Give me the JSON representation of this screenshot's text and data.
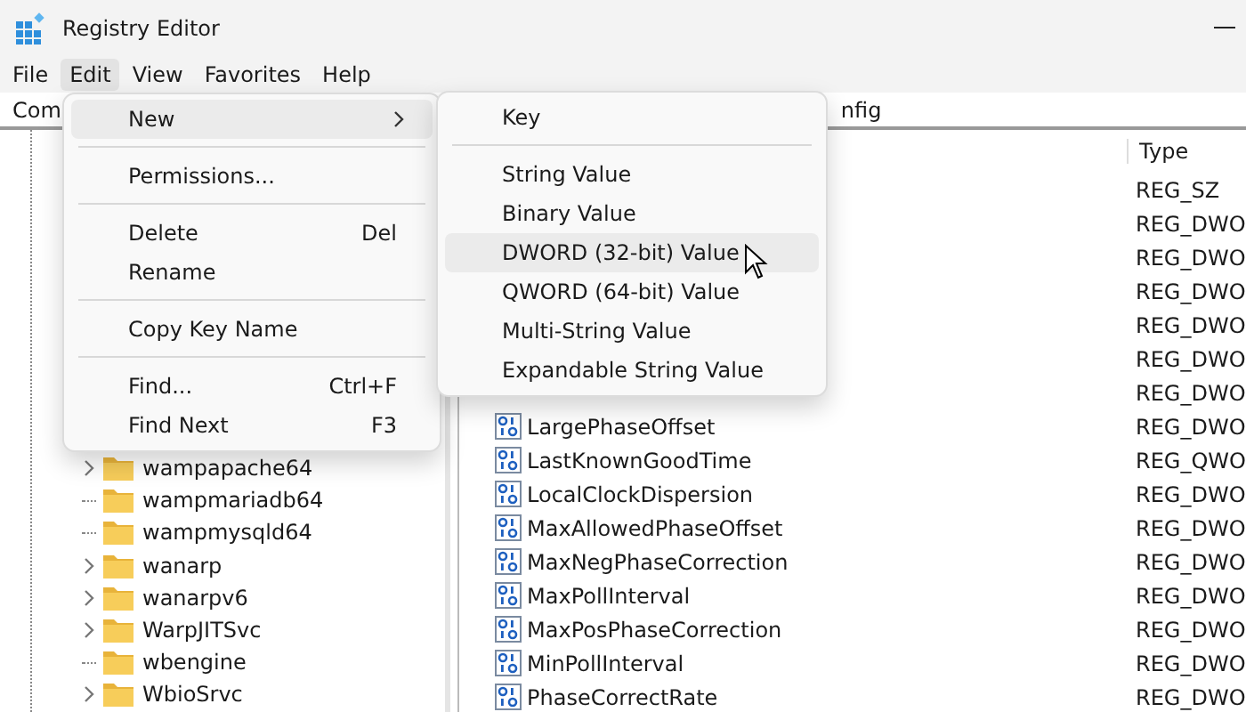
{
  "window": {
    "title": "Registry Editor"
  },
  "menubar": [
    {
      "label": "File",
      "selected": false
    },
    {
      "label": "Edit",
      "selected": true
    },
    {
      "label": "View",
      "selected": false
    },
    {
      "label": "Favorites",
      "selected": false
    },
    {
      "label": "Help",
      "selected": false
    }
  ],
  "address": {
    "start": "Com",
    "end": "nfig"
  },
  "tree": [
    {
      "label": "wampapache64",
      "expandable": true
    },
    {
      "label": "wampmariadb64",
      "expandable": false
    },
    {
      "label": "wampmysqld64",
      "expandable": false
    },
    {
      "label": "wanarp",
      "expandable": true
    },
    {
      "label": "wanarpv6",
      "expandable": true
    },
    {
      "label": "WarpJITSvc",
      "expandable": true
    },
    {
      "label": "wbengine",
      "expandable": false
    },
    {
      "label": "WbioSrvc",
      "expandable": true
    }
  ],
  "values": {
    "type_header": "Type",
    "rows": [
      {
        "type": "REG_SZ"
      },
      {
        "type": "REG_DWO"
      },
      {
        "type": "REG_DWO"
      },
      {
        "type": "REG_DWO"
      },
      {
        "type": "REG_DWO"
      },
      {
        "type": "REG_DWO"
      },
      {
        "type": "REG_DWO"
      },
      {
        "name": "LargePhaseOffset",
        "type": "REG_DWO"
      },
      {
        "name": "LastKnownGoodTime",
        "type": "REG_QWO"
      },
      {
        "name": "LocalClockDispersion",
        "type": "REG_DWO"
      },
      {
        "name": "MaxAllowedPhaseOffset",
        "type": "REG_DWO"
      },
      {
        "name": "MaxNegPhaseCorrection",
        "type": "REG_DWO"
      },
      {
        "name": "MaxPollInterval",
        "type": "REG_DWO"
      },
      {
        "name": "MaxPosPhaseCorrection",
        "type": "REG_DWO"
      },
      {
        "name": "MinPollInterval",
        "type": "REG_DWO"
      },
      {
        "name": "PhaseCorrectRate",
        "type": "REG_DWO"
      }
    ]
  },
  "edit_menu": [
    {
      "kind": "item",
      "label": "New",
      "submenu": true,
      "selected": true
    },
    {
      "kind": "separator"
    },
    {
      "kind": "item",
      "label": "Permissions...",
      "selected": false
    },
    {
      "kind": "separator"
    },
    {
      "kind": "item",
      "label": "Delete",
      "shortcut": "Del",
      "selected": false
    },
    {
      "kind": "item",
      "label": "Rename",
      "selected": false
    },
    {
      "kind": "separator"
    },
    {
      "kind": "item",
      "label": "Copy Key Name",
      "selected": false
    },
    {
      "kind": "separator"
    },
    {
      "kind": "item",
      "label": "Find...",
      "shortcut": "Ctrl+F",
      "selected": false
    },
    {
      "kind": "item",
      "label": "Find Next",
      "shortcut": "F3",
      "selected": false
    }
  ],
  "new_submenu": [
    {
      "kind": "item",
      "label": "Key",
      "selected": false
    },
    {
      "kind": "separator"
    },
    {
      "kind": "item",
      "label": "String Value",
      "selected": false
    },
    {
      "kind": "item",
      "label": "Binary Value",
      "selected": false
    },
    {
      "kind": "item",
      "label": "DWORD (32-bit) Value",
      "selected": true
    },
    {
      "kind": "item",
      "label": "QWORD (64-bit) Value",
      "selected": false
    },
    {
      "kind": "item",
      "label": "Multi-String Value",
      "selected": false
    },
    {
      "kind": "item",
      "label": "Expandable String Value",
      "selected": false
    }
  ]
}
